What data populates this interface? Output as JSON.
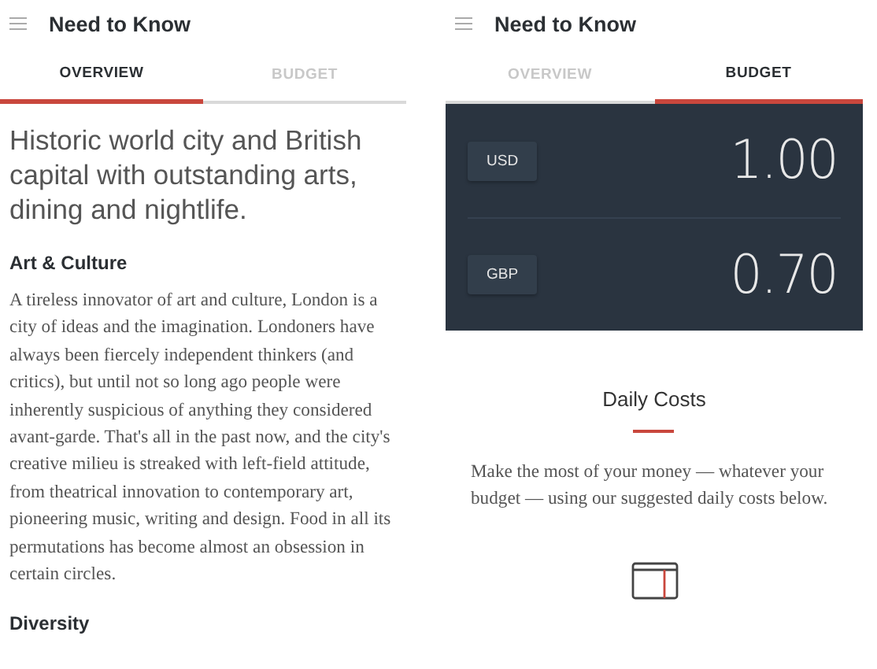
{
  "screens": [
    {
      "kind": "overview",
      "title": "Need to Know",
      "tabs": [
        {
          "label": "OVERVIEW",
          "selected": true
        },
        {
          "label": "BUDGET",
          "selected": false
        }
      ],
      "lead": "Historic world city and British capital with outstanding arts, dining and nightlife.",
      "sections": [
        {
          "heading": "Art & Culture",
          "body": "A tireless innovator of art and culture, London is a city of ideas and the imagination. Londoners have always been fiercely independent thinkers (and critics), but until not so long ago people were inherently suspicious of anything they considered avant-garde. That's all in the past now, and the city's creative milieu is streaked with left-field attitude, from theatrical innovation to contemporary art, pioneering music, writing and design. Food in all its permutations has become almost an obsession in certain circles."
        },
        {
          "heading": "Diversity"
        }
      ]
    },
    {
      "kind": "budget",
      "title": "Need to Know",
      "tabs": [
        {
          "label": "OVERVIEW",
          "selected": false
        },
        {
          "label": "BUDGET",
          "selected": true
        }
      ],
      "currencies": [
        {
          "code": "USD",
          "amount": "1.00"
        },
        {
          "code": "GBP",
          "amount": "0.70"
        }
      ],
      "heading": "Daily Costs",
      "body": "Make the most of your money — whatever your budget — using our suggested daily costs below."
    }
  ]
}
